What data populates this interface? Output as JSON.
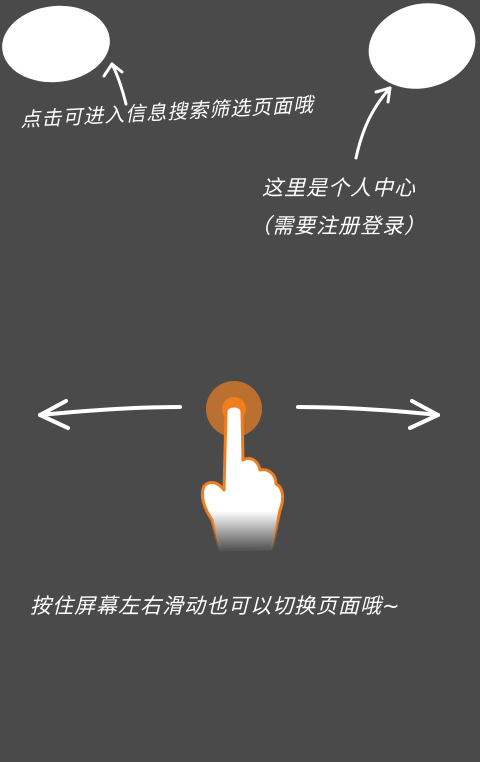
{
  "overlay": {
    "search_hint": "点击可进入信息搜索筛选页面哦",
    "profile_hint_line1": "这里是个人中心",
    "profile_hint_line2": "（需要注册登录）",
    "swipe_hint": "按住屏幕左右滑动也可以切换页面哦~"
  },
  "colors": {
    "background": "#4a4a4a",
    "accent": "#f07d1e",
    "accent_halo": "#d9782a",
    "foreground": "#ffffff"
  },
  "icons": {
    "left_arrow": "arrow-left-icon",
    "right_arrow": "arrow-right-icon",
    "hand": "finger-swipe-icon"
  }
}
